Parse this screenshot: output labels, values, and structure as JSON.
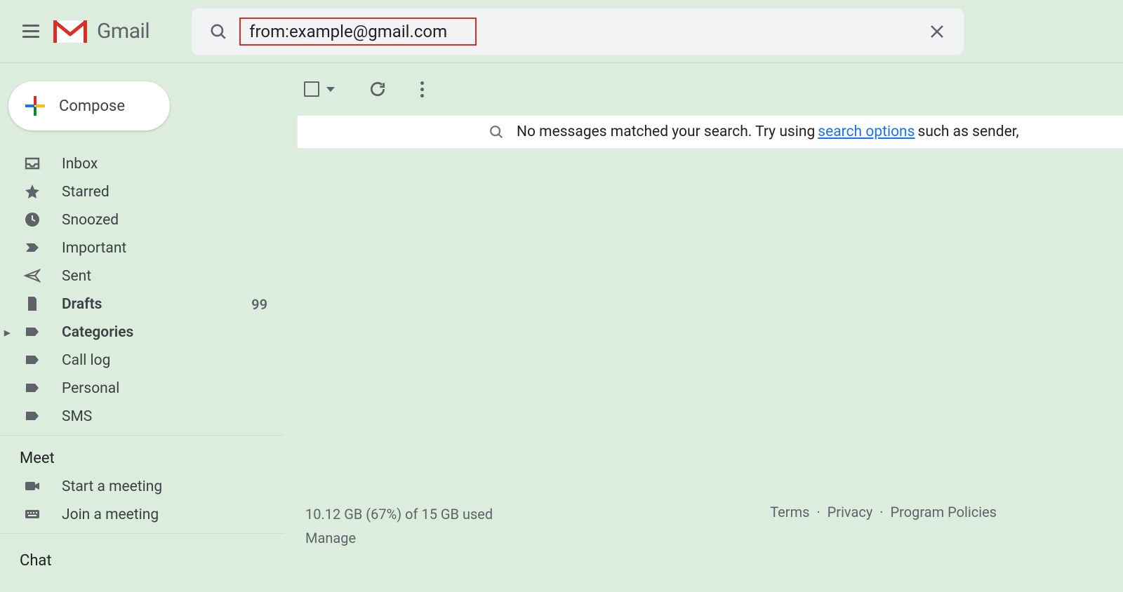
{
  "header": {
    "app_name": "Gmail",
    "search_value": "from:example@gmail.com"
  },
  "compose": {
    "label": "Compose"
  },
  "sidebar": {
    "items": [
      {
        "label": "Inbox",
        "icon": "inbox",
        "bold": false,
        "count": ""
      },
      {
        "label": "Starred",
        "icon": "star",
        "bold": false,
        "count": ""
      },
      {
        "label": "Snoozed",
        "icon": "clock",
        "bold": false,
        "count": ""
      },
      {
        "label": "Important",
        "icon": "important",
        "bold": false,
        "count": ""
      },
      {
        "label": "Sent",
        "icon": "send",
        "bold": false,
        "count": ""
      },
      {
        "label": "Drafts",
        "icon": "file",
        "bold": true,
        "count": "99"
      },
      {
        "label": "Categories",
        "icon": "label",
        "bold": true,
        "count": "",
        "expandable": true
      },
      {
        "label": "Call log",
        "icon": "label",
        "bold": false,
        "count": ""
      },
      {
        "label": "Personal",
        "icon": "label",
        "bold": false,
        "count": ""
      },
      {
        "label": "SMS",
        "icon": "label",
        "bold": false,
        "count": ""
      }
    ]
  },
  "meet": {
    "title": "Meet",
    "items": [
      {
        "label": "Start a meeting",
        "icon": "video"
      },
      {
        "label": "Join a meeting",
        "icon": "keyboard"
      }
    ]
  },
  "chat": {
    "title": "Chat"
  },
  "result": {
    "prefix": "No messages matched your search. Try using ",
    "link": "search options",
    "suffix": " such as sender,"
  },
  "footer": {
    "storage": "10.12 GB (67%) of 15 GB used",
    "manage": "Manage",
    "links": {
      "terms": "Terms",
      "privacy": "Privacy",
      "program": "Program Policies"
    }
  }
}
